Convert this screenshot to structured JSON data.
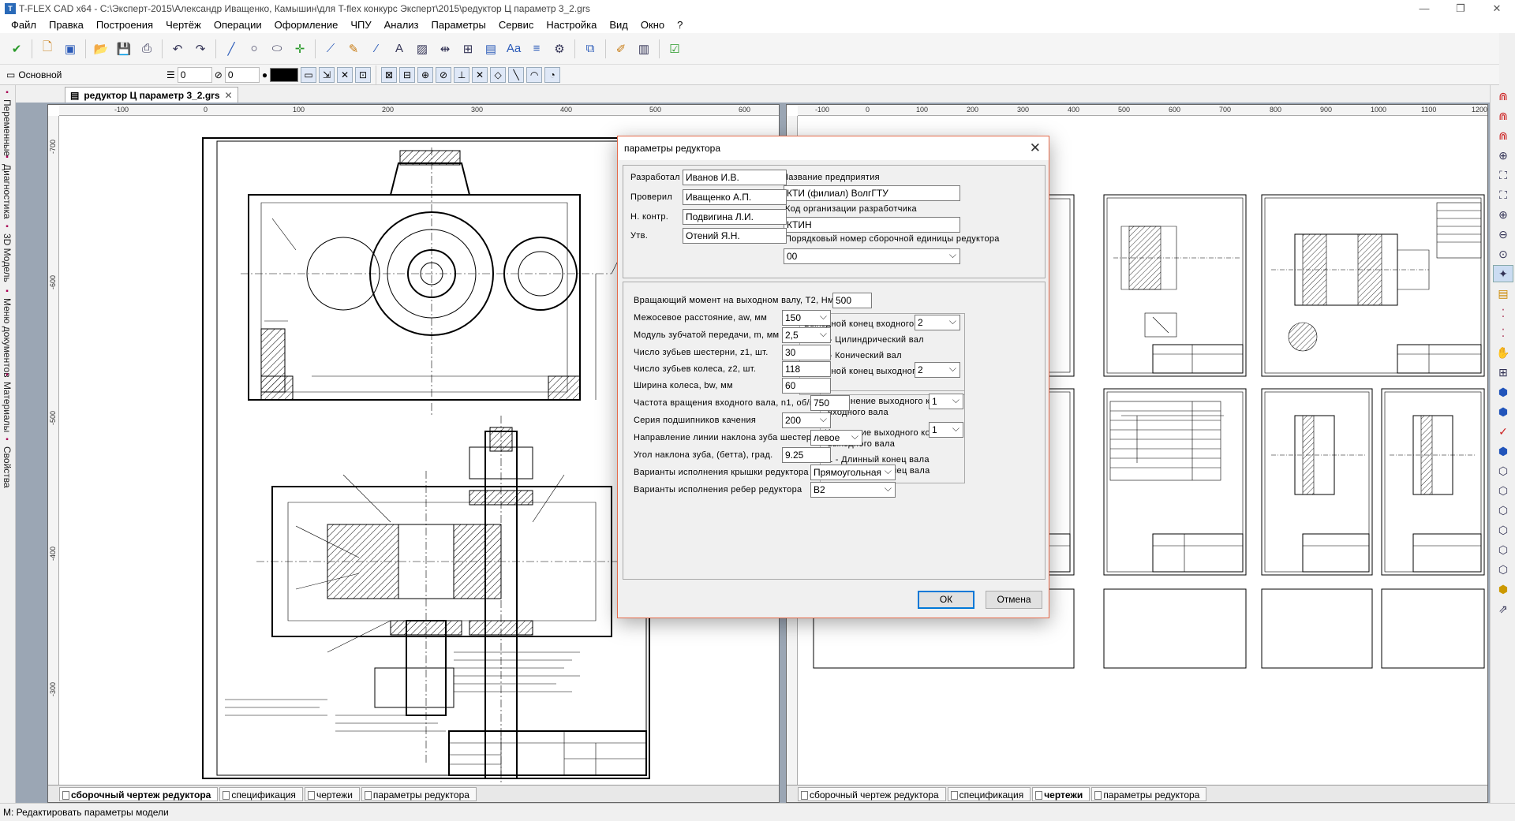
{
  "window": {
    "title": "T-FLEX CAD x64 - C:\\Эксперт-2015\\Александр Иващенко, Камышин\\для T-flex конкурс Эксперт\\2015\\редуктор Ц параметр 3_2.grs"
  },
  "menu": [
    "Файл",
    "Правка",
    "Построения",
    "Чертёж",
    "Операции",
    "Оформление",
    "ЧПУ",
    "Анализ",
    "Параметры",
    "Сервис",
    "Настройка",
    "Вид",
    "Окно",
    "?"
  ],
  "toolbar2": {
    "layer": "Основной",
    "value1": "0",
    "value2": "0"
  },
  "left_tabs": [
    "Переменные",
    "Диагностика",
    "3D Модель",
    "Меню документов",
    "Материалы",
    "Свойства"
  ],
  "document_tab": "редуктор Ц параметр 3_2.grs",
  "left_pane": {
    "ruler_h": [
      "-100",
      "0",
      "100",
      "200",
      "300",
      "400",
      "500",
      "600"
    ],
    "ruler_v": [
      "-700",
      "-600",
      "-500",
      "-400",
      "-300"
    ],
    "page_tabs": [
      "сборочный чертеж редуктора",
      "спецификация",
      "чертежи",
      "параметры редуктора"
    ],
    "active_tab": 0
  },
  "right_pane": {
    "ruler_h": [
      "-100",
      "0",
      "100",
      "200",
      "300",
      "400",
      "500",
      "600",
      "700",
      "800",
      "900",
      "1000",
      "1100",
      "1200"
    ],
    "ruler_v": [
      "-300"
    ],
    "page_tabs": [
      "сборочный чертеж редуктора",
      "спецификация",
      "чертежи",
      "параметры редуктора"
    ],
    "active_tab": 2
  },
  "dialog": {
    "title": "параметры редуктора",
    "close": "✕",
    "signatures": [
      {
        "label": "Разработал",
        "value": "Иванов И.В."
      },
      {
        "label": "Проверил",
        "value": "Иващенко А.П."
      },
      {
        "label": "Н. контр.",
        "value": "Подвигина Л.И."
      },
      {
        "label": "Утв.",
        "value": "Отений Я.Н."
      }
    ],
    "company_label": "Название предприятия",
    "company_value": "КТИ (филиал) ВолгГТУ",
    "org_code_label": "Код организации разработчика",
    "org_code_value": "КТИН",
    "assembly_no_label": "Порядковый номер сборочной единицы редуктора",
    "assembly_no_value": "00",
    "params": [
      {
        "label": "Вращающий момент на выходном валу, Т2, Нм",
        "value": "500",
        "kind": "input"
      },
      {
        "label": "Межосевое расстояние, aw, мм",
        "value": "150",
        "kind": "select"
      },
      {
        "label": "Модуль зубчатой передачи, m, мм",
        "value": "2,5",
        "kind": "select"
      },
      {
        "label": "Число зубьев шестерни, z1, шт.",
        "value": "30",
        "kind": "input"
      },
      {
        "label": "Число зубьев колеса, z2, шт.",
        "value": "118",
        "kind": "input"
      },
      {
        "label": "Ширина колеса, bw, мм",
        "value": "60",
        "kind": "input"
      },
      {
        "label": "Частота вращения входного вала, n1, об/мин.",
        "value": "750",
        "kind": "input"
      },
      {
        "label": "Серия подшипников качения",
        "value": "200",
        "kind": "select"
      },
      {
        "label": "Направление линии наклона зуба шестерни",
        "value": "левое",
        "kind": "select"
      },
      {
        "label": "Угол наклона зуба, (бетта), град.",
        "value": "9.25",
        "kind": "input"
      },
      {
        "label": "Варианты исполнения крышки редуктора",
        "value": "Прямоугольная",
        "kind": "select"
      },
      {
        "label": "Варианты исполнения ребер редуктора",
        "value": "B2",
        "kind": "select"
      }
    ],
    "shaft_end": {
      "input_label": "Выходной конец входного вала",
      "input_value": "2",
      "opt1": "1 - Цилиндрический вал",
      "opt2": "2 - Конический вал",
      "output_label": "Выходной конец выходного вала",
      "output_value": "2"
    },
    "shaft_exec": {
      "input_label_1": "Исполнение выходного конца",
      "input_label_2": "входного вала",
      "input_value": "1",
      "output_label_1": "Иполнение выходного конца",
      "output_label_2": "выходного вала",
      "output_value": "1",
      "opt1": "1 - Длинный конец вала",
      "opt2": "2 - Короткий конец вала"
    },
    "ok": "ОК",
    "cancel": "Отмена"
  },
  "status": "М: Редактировать параметры модели"
}
